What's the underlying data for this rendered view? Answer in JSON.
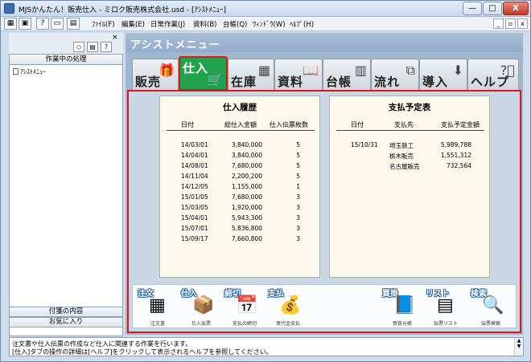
{
  "window": {
    "title": "MJSかんたん！販売仕入 - ミロク販売株式会社.usd - [ｱｼｽﾄﾒﾆｭｰ]",
    "min_label": "—",
    "max_label": "□",
    "close_label": "X"
  },
  "menubar": {
    "items": [
      "ﾌｧｲﾙ(F)",
      "編集(E)",
      "日常作業(J)",
      "資料(B)",
      "台帳(Q)",
      "ｳｨﾝﾄﾞｳ(W)",
      "ﾍﾙﾌﾟ(H)"
    ],
    "mdi_min": "_",
    "mdi_restore": "▫",
    "mdi_close": "x"
  },
  "leftpane": {
    "close": "×",
    "header": "作業中の処理",
    "list_item": "ｱｼｽﾄﾒﾆｭｰ",
    "fav_button": "付箋の内容",
    "bookmark_button": "お気に入り"
  },
  "main": {
    "title": "アシストメニュー",
    "tabs": [
      {
        "label": "販売",
        "icon": "gift-icon"
      },
      {
        "label": "仕入",
        "icon": "cart-icon"
      },
      {
        "label": "在庫",
        "icon": "boxes-icon"
      },
      {
        "label": "資料",
        "icon": "book-icon"
      },
      {
        "label": "台帳",
        "icon": "binders-icon"
      },
      {
        "label": "流れ",
        "icon": "flow-icon"
      },
      {
        "label": "導入",
        "icon": "install-icon"
      },
      {
        "label": "ヘルプ",
        "icon": "help-icon"
      }
    ]
  },
  "purchase_history": {
    "title": "仕入履歴",
    "columns": [
      "日付",
      "総仕入金額",
      "仕入伝票枚数"
    ],
    "rows": [
      [
        "14/03/01",
        "3,840,000",
        "5"
      ],
      [
        "14/04/01",
        "3,840,000",
        "5"
      ],
      [
        "14/08/01",
        "7,680,000",
        "5"
      ],
      [
        "14/11/04",
        "2,200,200",
        "5"
      ],
      [
        "14/12/05",
        "1,155,000",
        "1"
      ],
      [
        "15/01/05",
        "7,680,000",
        "3"
      ],
      [
        "15/03/05",
        "1,920,000",
        "3"
      ],
      [
        "15/04/01",
        "5,943,300",
        "3"
      ],
      [
        "15/07/01",
        "5,836,800",
        "3"
      ],
      [
        "15/09/17",
        "7,660,800",
        "3"
      ]
    ]
  },
  "payment_schedule": {
    "title": "支払予定表",
    "columns": [
      "日付",
      "支払先",
      "支払予定金額"
    ],
    "date": "15/10/31",
    "rows": [
      [
        "埼玉鉄工",
        "5,989,788"
      ],
      [
        "栃木販売",
        "1,551,312"
      ],
      [
        "名古屋販売",
        "732,564"
      ]
    ]
  },
  "tools": [
    {
      "big": "注文",
      "small": "注文書",
      "icon": "order-sheet-icon"
    },
    {
      "big": "仕入",
      "small": "仕入伝票",
      "icon": "box-icon"
    },
    {
      "big": "締切",
      "small": "支払の締切",
      "icon": "calendar-icon"
    },
    {
      "big": "支払",
      "small": "買代金支払",
      "icon": "moneybag-icon"
    },
    {
      "big": "買掛",
      "small": "買掛元帳",
      "icon": "ledger-icon"
    },
    {
      "big": "リスト",
      "small": "伝票リスト",
      "icon": "list-icon"
    },
    {
      "big": "検索",
      "small": "伝票検索",
      "icon": "magnifier-icon"
    }
  ],
  "status": {
    "line1": "注文書や仕入伝票の作成など仕入に関連する作業を行います。",
    "line2": "[仕入]タブの操作の詳細は[ヘルプ]をクリックして表示されるヘルプを参照してください。"
  },
  "colors": {
    "active_tab": "#22a24c",
    "highlight": "#e01515",
    "panel_bg": "#fdf8ec"
  }
}
